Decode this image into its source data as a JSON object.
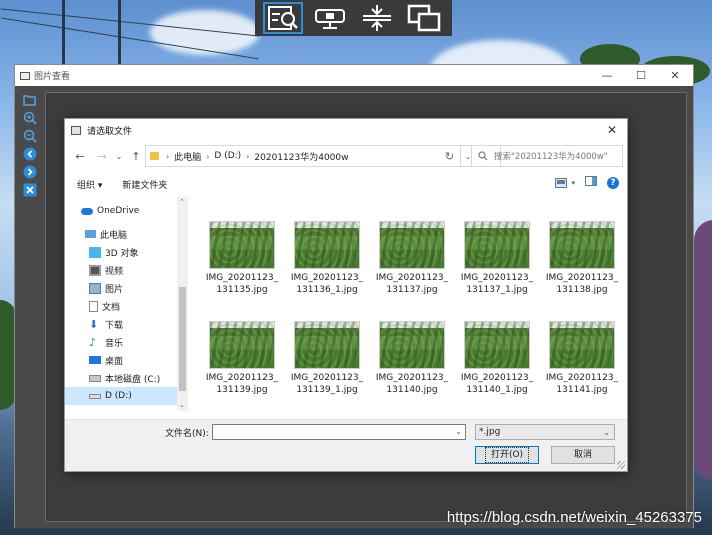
{
  "toolbar": {
    "buttons": [
      {
        "name": "zoom-fit-button",
        "icon": "image-search-icon",
        "active": true
      },
      {
        "name": "monitor-button",
        "icon": "monitor-icon",
        "active": false
      },
      {
        "name": "compress-button",
        "icon": "compress-vertical-icon",
        "active": false
      },
      {
        "name": "copy-windows-button",
        "icon": "copy-windows-icon",
        "active": false
      }
    ]
  },
  "viewer": {
    "title": "图片查看",
    "window_controls": [
      "—",
      "☐",
      "✕"
    ],
    "sidebar": [
      "folder-open-icon",
      "zoom-in-icon",
      "zoom-out-icon",
      "prev-icon",
      "next-icon",
      "rotate-icon"
    ]
  },
  "dialog": {
    "title": "请选取文件",
    "close": "✕",
    "nav": {
      "back": "←",
      "forward": "→",
      "recent": "⌄",
      "up": "↑",
      "refresh": "↻",
      "dropdown": "⌄"
    },
    "breadcrumb": [
      "此电脑",
      "D (D:)",
      "20201123华为4000w"
    ],
    "search_placeholder": "搜索\"20201123华为4000w\"",
    "commands": {
      "organize": "组织 ▾",
      "new_folder": "新建文件夹",
      "help": "?"
    },
    "nav_items": [
      {
        "label": "OneDrive",
        "icon": "cloud-icon"
      },
      {
        "label": "此电脑",
        "icon": "computer-icon"
      },
      {
        "label": "3D 对象",
        "icon": "cube-icon"
      },
      {
        "label": "视频",
        "icon": "video-icon"
      },
      {
        "label": "图片",
        "icon": "pictures-icon"
      },
      {
        "label": "文档",
        "icon": "document-icon"
      },
      {
        "label": "下载",
        "icon": "download-icon"
      },
      {
        "label": "音乐",
        "icon": "music-icon"
      },
      {
        "label": "桌面",
        "icon": "desktop-icon"
      },
      {
        "label": "本地磁盘 (C:)",
        "icon": "drive-c-icon"
      },
      {
        "label": "D (D:)",
        "icon": "drive-d-icon"
      }
    ],
    "files": [
      {
        "line1": "IMG_20201123_",
        "line2": "131135.jpg"
      },
      {
        "line1": "IMG_20201123_",
        "line2": "131136_1.jpg"
      },
      {
        "line1": "IMG_20201123_",
        "line2": "131137.jpg"
      },
      {
        "line1": "IMG_20201123_",
        "line2": "131137_1.jpg"
      },
      {
        "line1": "IMG_20201123_",
        "line2": "131138.jpg"
      },
      {
        "line1": "IMG_20201123_",
        "line2": "131139.jpg"
      },
      {
        "line1": "IMG_20201123_",
        "line2": "131139_1.jpg"
      },
      {
        "line1": "IMG_20201123_",
        "line2": "131140.jpg"
      },
      {
        "line1": "IMG_20201123_",
        "line2": "131140_1.jpg"
      },
      {
        "line1": "IMG_20201123_",
        "line2": "131141.jpg"
      }
    ],
    "filename_label": "文件名(N):",
    "filename_value": "",
    "filter": "*.jpg",
    "open_button": "打开(O)",
    "cancel_button": "取消"
  },
  "watermark": "https://blog.csdn.net/weixin_45263375"
}
